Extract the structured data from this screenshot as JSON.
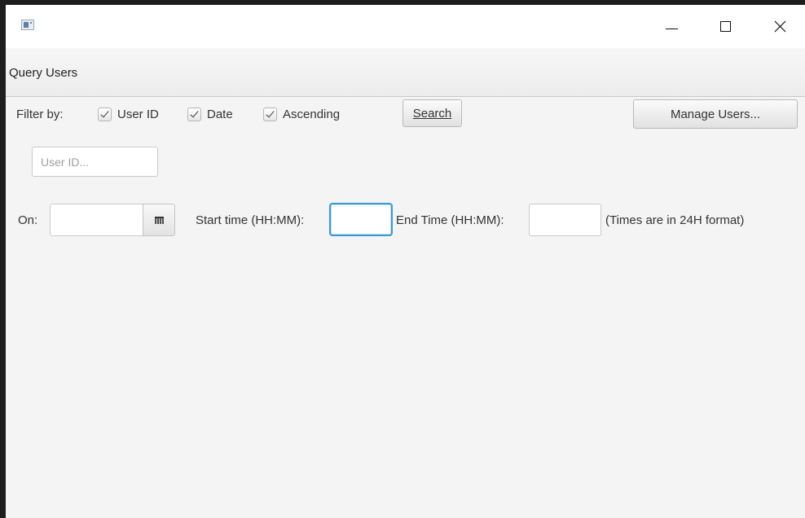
{
  "window": {
    "title": "",
    "controls": {
      "minimize": "—",
      "maximize": "☐",
      "close": "✕"
    }
  },
  "header": {
    "title": "Query Users"
  },
  "filter": {
    "label": "Filter by:",
    "options": [
      {
        "label": "User ID",
        "checked": true
      },
      {
        "label": "Date",
        "checked": true
      },
      {
        "label": "Ascending",
        "checked": true
      }
    ]
  },
  "toolbar": {
    "search_label": "Search",
    "manage_label": "Manage Users..."
  },
  "userid": {
    "placeholder": "User ID...",
    "value": ""
  },
  "date": {
    "on_label": "On:",
    "value": "",
    "start_label": "Start time (HH:MM):",
    "start_value": "",
    "end_label": "End Time (HH:MM):",
    "end_value": "",
    "note": "(Times are in 24H format)"
  },
  "colors": {
    "focus_accent": "#3a9ad9",
    "background": "#f4f4f4"
  },
  "icons": {
    "calendar": "calendar-icon",
    "app": "app-icon"
  }
}
